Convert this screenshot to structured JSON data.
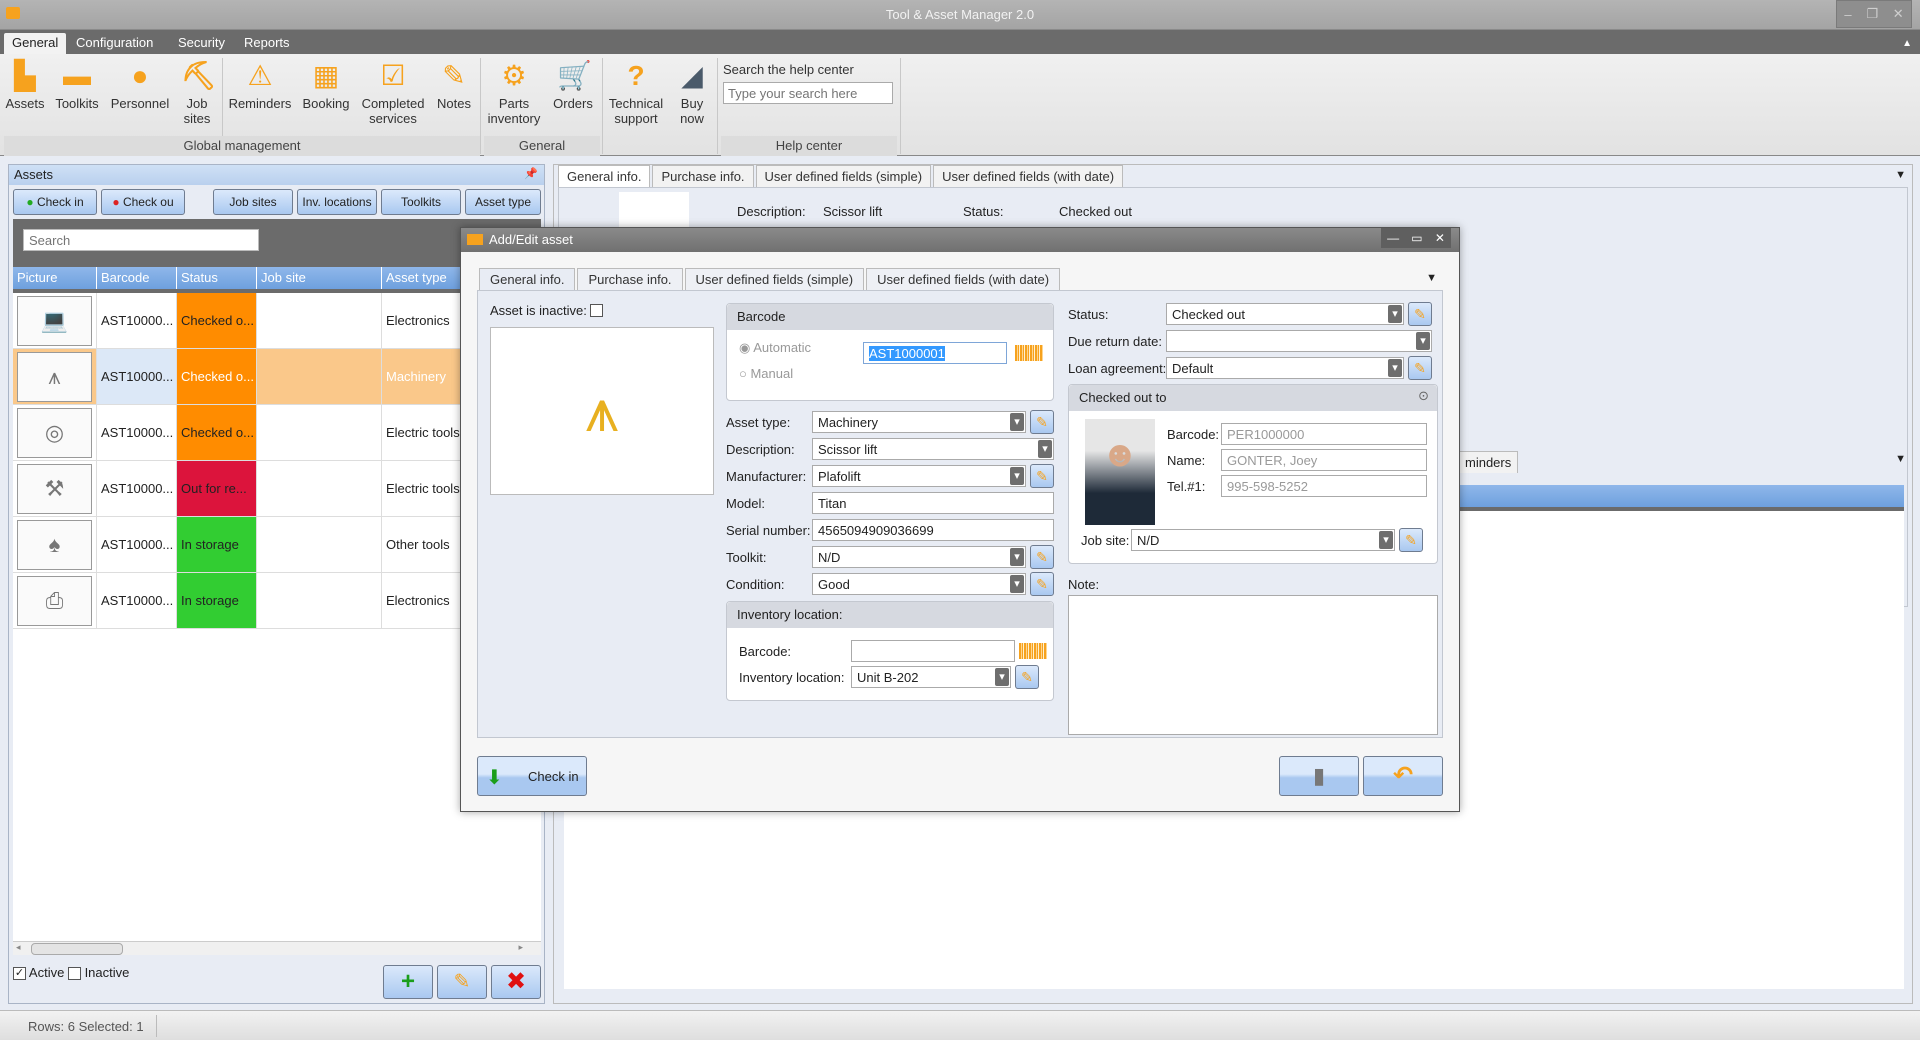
{
  "window": {
    "title": "Tool & Asset Manager 2.0",
    "controls": [
      "–",
      "❐",
      "✕"
    ]
  },
  "ribbon": {
    "tabs": [
      "General",
      "Configuration",
      "Security",
      "Reports"
    ],
    "active_tab": "General",
    "buttons": [
      {
        "label": "Assets",
        "icon": "drill-barcode-icon"
      },
      {
        "label": "Toolkits",
        "icon": "toolbox-icon"
      },
      {
        "label": "Personnel",
        "icon": "person-icon"
      },
      {
        "label": "Job\nsites",
        "icon": "digging-worker-icon"
      },
      {
        "label": "Reminders",
        "icon": "warning-triangle-icon"
      },
      {
        "label": "Booking",
        "icon": "calendar-icon"
      },
      {
        "label": "Completed\nservices",
        "icon": "checkbox-icon"
      },
      {
        "label": "Notes",
        "icon": "note-pencil-icon"
      },
      {
        "label": "Parts\ninventory",
        "icon": "gears-icon"
      },
      {
        "label": "Orders",
        "icon": "cart-icon"
      },
      {
        "label": "Technical\nsupport",
        "icon": "question-icon"
      },
      {
        "label": "Buy\nnow",
        "icon": "buy-icon"
      }
    ],
    "groups": [
      "Global management",
      "General",
      "Help center"
    ],
    "help": {
      "label": "Search the help center",
      "placeholder": "Type your search here"
    }
  },
  "assets_panel": {
    "title": "Assets",
    "toolbar": [
      "Check in",
      "Check ou",
      "Job sites",
      "Inv. locations",
      "Toolkits",
      "Asset type"
    ],
    "search_placeholder": "Search",
    "columns": [
      "Picture",
      "Barcode",
      "Status",
      "Job site",
      "Asset type"
    ],
    "rows": [
      {
        "picture": "laptop",
        "barcode": "AST10000...",
        "status": "Checked o...",
        "status_color": "#ff8c00",
        "job_site": "",
        "asset_type": "Electronics",
        "selected": false
      },
      {
        "picture": "scissor-lift",
        "barcode": "AST10000...",
        "status": "Checked o...",
        "status_color": "#ff8c00",
        "job_site": "",
        "asset_type": "Machinery",
        "selected": true
      },
      {
        "picture": "circular-saw",
        "barcode": "AST10000...",
        "status": "Checked o...",
        "status_color": "#ff8c00",
        "job_site": "",
        "asset_type": "Electric tools",
        "selected": false
      },
      {
        "picture": "multi-tool",
        "barcode": "AST10000...",
        "status": "Out for re...",
        "status_color": "#dc143c",
        "job_site": "",
        "asset_type": "Electric tools",
        "selected": false
      },
      {
        "picture": "shovel",
        "barcode": "AST10000...",
        "status": "In storage",
        "status_color": "#32cd32",
        "job_site": "",
        "asset_type": "Other tools",
        "selected": false
      },
      {
        "picture": "printer",
        "barcode": "AST10000...",
        "status": "In storage",
        "status_color": "#32cd32",
        "job_site": "",
        "asset_type": "Electronics",
        "selected": false
      }
    ],
    "filters": {
      "active_label": "Active",
      "active_checked": true,
      "inactive_label": "Inactive",
      "inactive_checked": false
    }
  },
  "detail_panel": {
    "tabs": [
      "General info.",
      "Purchase info.",
      "User defined fields (simple)",
      "User defined fields (with date)"
    ],
    "description_label": "Description:",
    "description": "Scissor lift",
    "status_label": "Status:",
    "status": "Checked out",
    "bottom_tab_partial": "minders"
  },
  "dialog": {
    "title": "Add/Edit asset",
    "tabs": [
      "General info.",
      "Purchase info.",
      "User defined fields (simple)",
      "User defined fields (with date)"
    ],
    "inactive_label": "Asset is inactive:",
    "barcode": {
      "title": "Barcode",
      "automatic": "Automatic",
      "manual": "Manual",
      "value": "AST1000001"
    },
    "fields": {
      "asset_type": {
        "label": "Asset type:",
        "value": "Machinery"
      },
      "description": {
        "label": "Description:",
        "value": "Scissor lift"
      },
      "manufacturer": {
        "label": "Manufacturer:",
        "value": "Plafolift"
      },
      "model": {
        "label": "Model:",
        "value": "Titan"
      },
      "serial": {
        "label": "Serial number:",
        "value": "4565094909036699"
      },
      "toolkit": {
        "label": "Toolkit:",
        "value": "N/D"
      },
      "condition": {
        "label": "Condition:",
        "value": "Good"
      }
    },
    "inventory": {
      "title": "Inventory location:",
      "barcode_label": "Barcode:",
      "barcode_value": "",
      "location_label": "Inventory location:",
      "location_value": "Unit B-202"
    },
    "status": {
      "label": "Status:",
      "value": "Checked out"
    },
    "due_date": {
      "label": "Due return date:",
      "value": ""
    },
    "loan": {
      "label": "Loan agreement:",
      "value": "Default"
    },
    "checked_out_to": {
      "title": "Checked out to",
      "barcode_label": "Barcode:",
      "barcode": "PER1000000",
      "name_label": "Name:",
      "name": "GONTER, Joey",
      "tel_label": "Tel.#1:",
      "tel": "995-598-5252",
      "jobsite_label": "Job site:",
      "jobsite": "N/D"
    },
    "note_label": "Note:",
    "note": "",
    "checkin_label": "Check in"
  },
  "statusbar": {
    "text": "Rows: 6  Selected: 1"
  }
}
